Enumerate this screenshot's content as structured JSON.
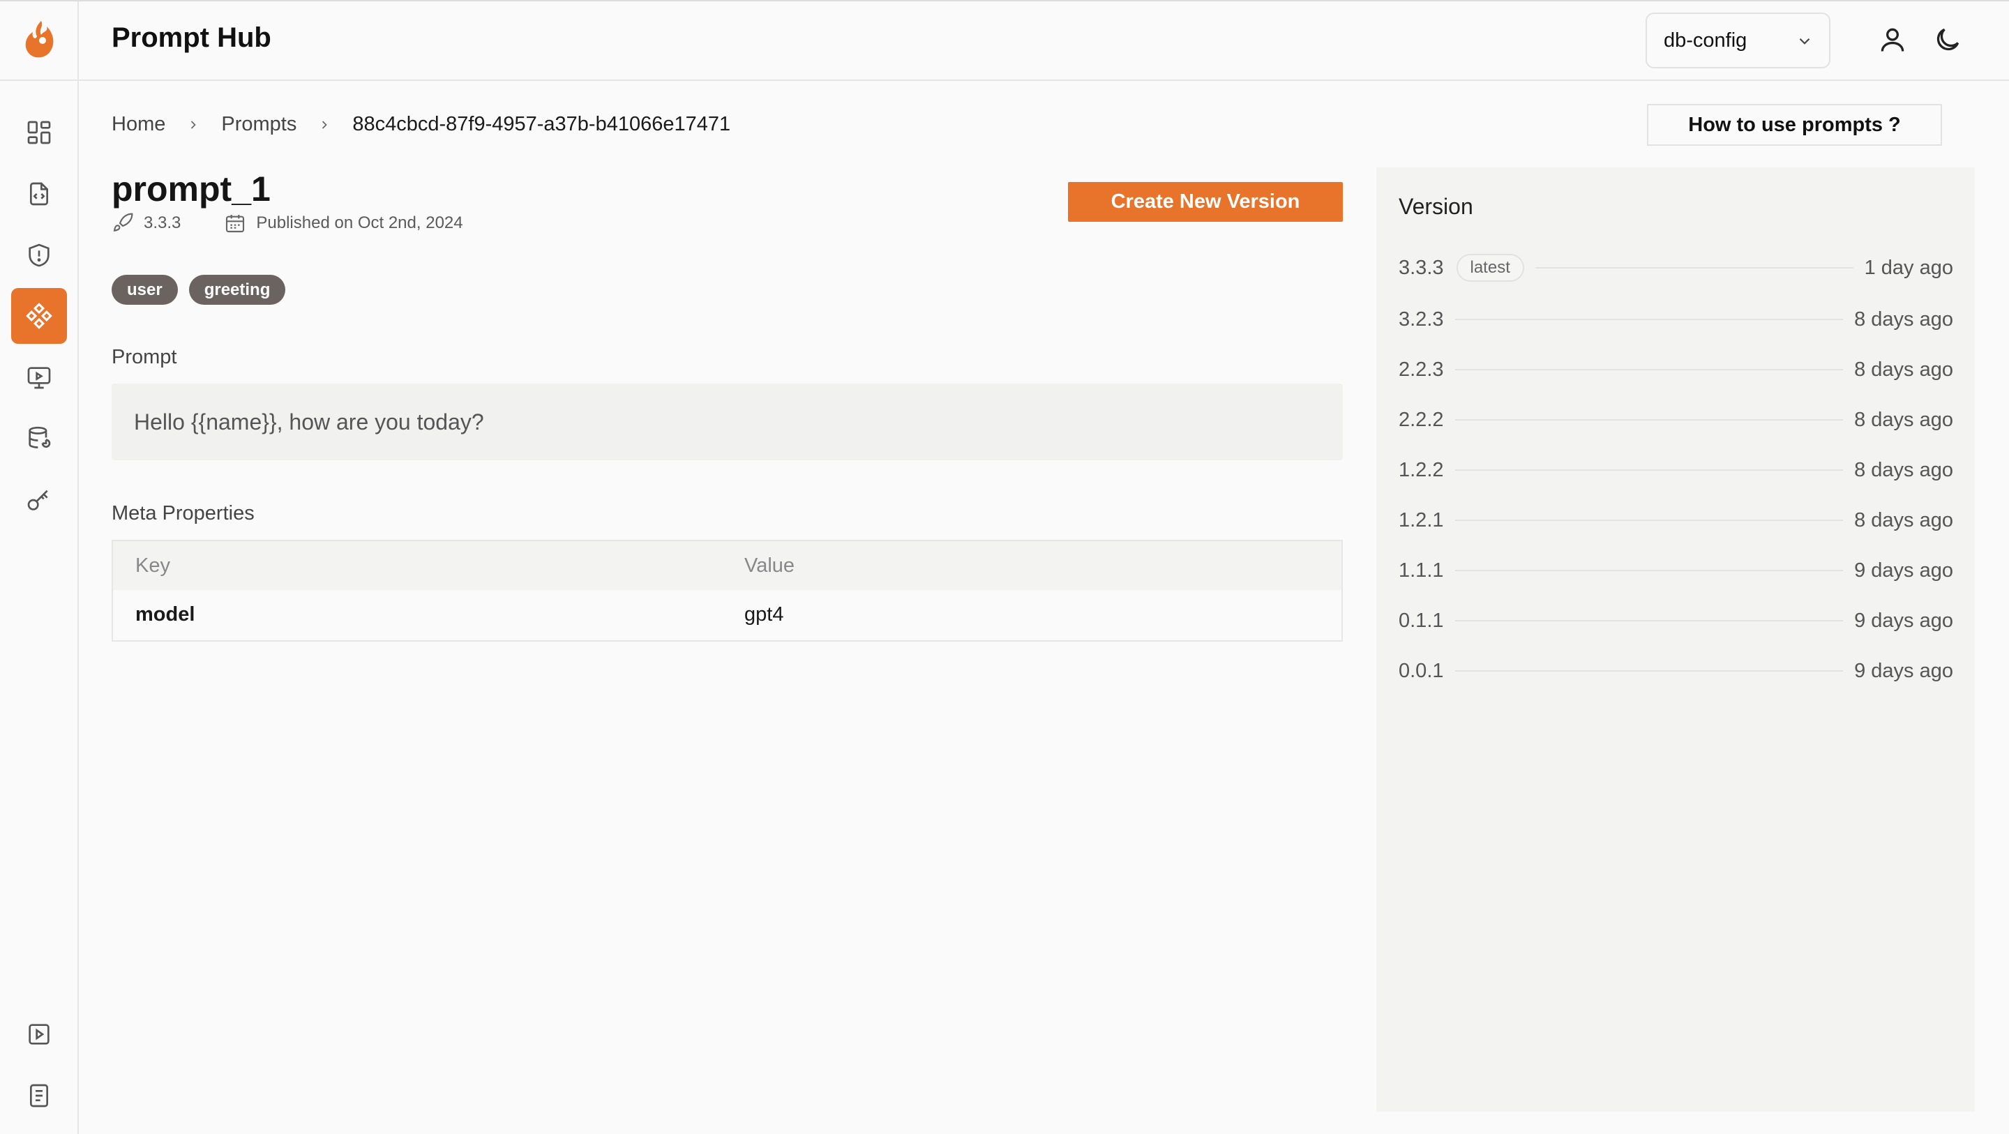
{
  "header": {
    "title": "Prompt Hub",
    "db_select": "db-config"
  },
  "breadcrumb": [
    "Home",
    "Prompts",
    "88c4cbcd-87f9-4957-a37b-b41066e17471"
  ],
  "help_button": "How to use prompts ?",
  "prompt": {
    "name": "prompt_1",
    "version": "3.3.3",
    "published": "Published on Oct 2nd, 2024",
    "tags": [
      "user",
      "greeting"
    ],
    "prompt_label": "Prompt",
    "text": "Hello {{name}}, how are you today?",
    "meta_label": "Meta Properties",
    "meta_headers": {
      "key": "Key",
      "value": "Value"
    },
    "meta_rows": [
      {
        "key": "model",
        "value": "gpt4"
      }
    ]
  },
  "create_button": "Create New Version",
  "versions": {
    "title": "Version",
    "latest_badge": "latest",
    "items": [
      {
        "version": "3.3.3",
        "ago": "1 day ago"
      },
      {
        "version": "3.2.3",
        "ago": "8 days ago"
      },
      {
        "version": "2.2.3",
        "ago": "8 days ago"
      },
      {
        "version": "2.2.2",
        "ago": "8 days ago"
      },
      {
        "version": "1.2.2",
        "ago": "8 days ago"
      },
      {
        "version": "1.2.1",
        "ago": "8 days ago"
      },
      {
        "version": "1.1.1",
        "ago": "9 days ago"
      },
      {
        "version": "0.1.1",
        "ago": "9 days ago"
      },
      {
        "version": "0.0.1",
        "ago": "9 days ago"
      }
    ]
  },
  "sidebar": {
    "items": [
      {
        "icon": "dashboard-icon",
        "active": false
      },
      {
        "icon": "file-code-icon",
        "active": false
      },
      {
        "icon": "shield-icon",
        "active": false
      },
      {
        "icon": "prompts-icon",
        "active": true
      },
      {
        "icon": "monitor-play-icon",
        "active": false
      },
      {
        "icon": "database-icon",
        "active": false
      },
      {
        "icon": "key-icon",
        "active": false
      }
    ],
    "bottom": [
      {
        "icon": "play-square-icon"
      },
      {
        "icon": "docs-icon"
      }
    ]
  },
  "colors": {
    "accent": "#e8742c",
    "tag_bg": "#6b6360"
  }
}
